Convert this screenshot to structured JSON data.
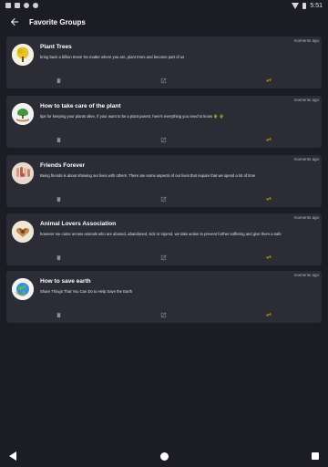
{
  "status_bar": {
    "time": "5:51",
    "icons": [
      "image-icon",
      "calendar-icon",
      "settings-icon",
      "circle-icon",
      "wifi-icon",
      "battery-icon"
    ]
  },
  "app_bar": {
    "title": "Favorite Groups",
    "back_icon": "arrow-left-icon"
  },
  "groups": [
    {
      "title": "Plant Trees",
      "description": "bring back a billion trees! No matter where you are,  plant trees and become part of us",
      "time": "moments ago",
      "avatar_icon": "tree-avatar-icon"
    },
    {
      "title": "How to take care of the plant",
      "description": "tips for keeping your plants alive, If your want to be a plant parent, here's everything you need to know 🌵 🌵",
      "time": "moments ago",
      "avatar_icon": "plant-in-hand-avatar-icon"
    },
    {
      "title": "Friends Forever",
      "description": "Being friends is about showing our lives with others. There are some aspects of our lives that require that we spend a lot of time",
      "time": "moments ago",
      "avatar_icon": "friends-hands-avatar-icon"
    },
    {
      "title": "Animal Lovers Association",
      "description": "however we came across animals who are abused, abandoned, sick or injured, we take action to prevent further suffering and give them a safe",
      "time": "moments ago",
      "avatar_icon": "paw-heart-avatar-icon"
    },
    {
      "title": "How to save earth",
      "description": "Share Things That You Can Do to Help Save the Earth",
      "time": "moments ago",
      "avatar_icon": "earth-avatar-icon"
    }
  ],
  "actions": {
    "delete_icon": "trash-icon",
    "share_icon": "share-icon",
    "link_icon": "link-icon",
    "link_color": "#f4b400"
  },
  "nav_bar": {
    "icons": [
      "back-triangle-icon",
      "home-circle-icon",
      "recents-square-icon"
    ]
  }
}
